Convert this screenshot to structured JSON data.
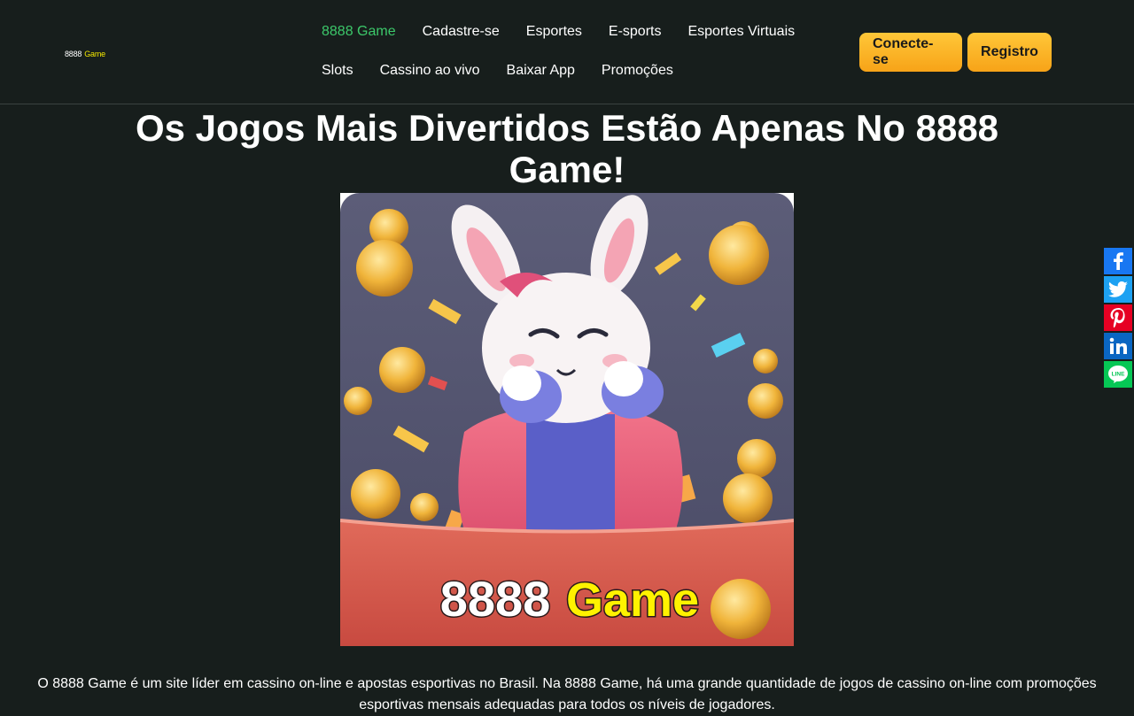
{
  "header": {
    "logo_number": "8888",
    "logo_word": "Game",
    "nav_row1": [
      "8888 Game",
      "Cadastre-se",
      "Esportes",
      "E-sports",
      "Esportes Virtuais"
    ],
    "nav_row2": [
      "Slots",
      "Cassino ao vivo",
      "Baixar App",
      "Promoções"
    ],
    "login_label": "Conecte-se",
    "register_label": "Registro"
  },
  "main": {
    "title": "Os Jogos Mais Divertidos Estão Apenas No 8888 Game!",
    "banner_text_number": "8888",
    "banner_text_word": "Game",
    "intro": "O 8888 Game é um site líder em cassino on-line e apostas esportivas no Brasil. Na 8888 Game, há uma grande quantidade de jogos de cassino on-line com promoções esportivas mensais adequadas para todos os níveis de jogadores."
  },
  "share": {
    "icons": [
      "facebook-icon",
      "twitter-icon",
      "pinterest-icon",
      "linkedin-icon",
      "line-icon"
    ],
    "line_label": "LINE",
    "colors": {
      "facebook": "#1877f2",
      "twitter": "#1da1f2",
      "pinterest": "#e60023",
      "linkedin": "#0a66c2",
      "line": "#06c755"
    }
  },
  "theme": {
    "background": "#171e1c",
    "accent_green": "#3cc86a",
    "button_gold": "#ffc738",
    "logo_yellow": "#f2e600"
  }
}
